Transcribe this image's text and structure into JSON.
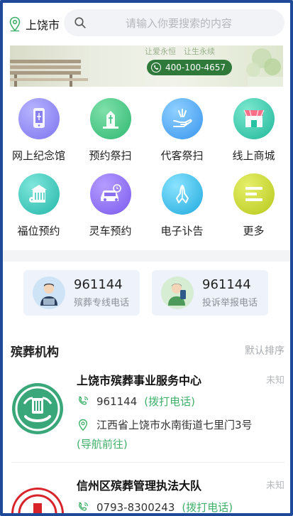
{
  "header": {
    "city": "上饶市",
    "search_placeholder": "请输入你要搜索的内容"
  },
  "banner": {
    "faint_text": "让爱永恒　让生永续",
    "phone": "400-100-4657"
  },
  "services": [
    {
      "label": "网上纪念馆",
      "icon": "phone-memorial-icon",
      "color": "#8a7ff0"
    },
    {
      "label": "预约祭扫",
      "icon": "tomb-sweep-icon",
      "color": "#34c27d"
    },
    {
      "label": "代客祭扫",
      "icon": "hand-offering-icon",
      "color": "#3ea5f0"
    },
    {
      "label": "线上商城",
      "icon": "shop-icon",
      "color": "#27c2a2"
    },
    {
      "label": "福位预约",
      "icon": "niche-icon",
      "color": "#2cc2b6"
    },
    {
      "label": "灵车预约",
      "icon": "hearse-icon",
      "color": "#8a6ff0"
    },
    {
      "label": "电子讣告",
      "icon": "praying-hands-icon",
      "color": "#2bb7e0"
    },
    {
      "label": "更多",
      "icon": "more-icon",
      "color": "#c9d62a"
    }
  ],
  "hotlines": [
    {
      "number": "961144",
      "label": "殡葬专线电话",
      "icon": "operator-avatar-icon"
    },
    {
      "number": "961144",
      "label": "投诉举报电话",
      "icon": "complaint-avatar-icon"
    }
  ],
  "section": {
    "title": "殡葬机构",
    "sort": "默认排序"
  },
  "orgs": [
    {
      "name": "上饶市殡葬事业服务中心",
      "status": "未知",
      "phone": "961144",
      "call_label": "(拨打电话)",
      "address": "江西省上饶市水南街道七里门3号",
      "nav_label": "(导航前往)"
    },
    {
      "name": "信州区殡葬管理执法大队",
      "status": "未知",
      "phone": "0793-8300243",
      "call_label": "(拨打电话)"
    }
  ],
  "colors": {
    "accent_green": "#3fb06a",
    "frame_blue": "#1f4a9a",
    "banner_pill": "#2f7a3b"
  }
}
